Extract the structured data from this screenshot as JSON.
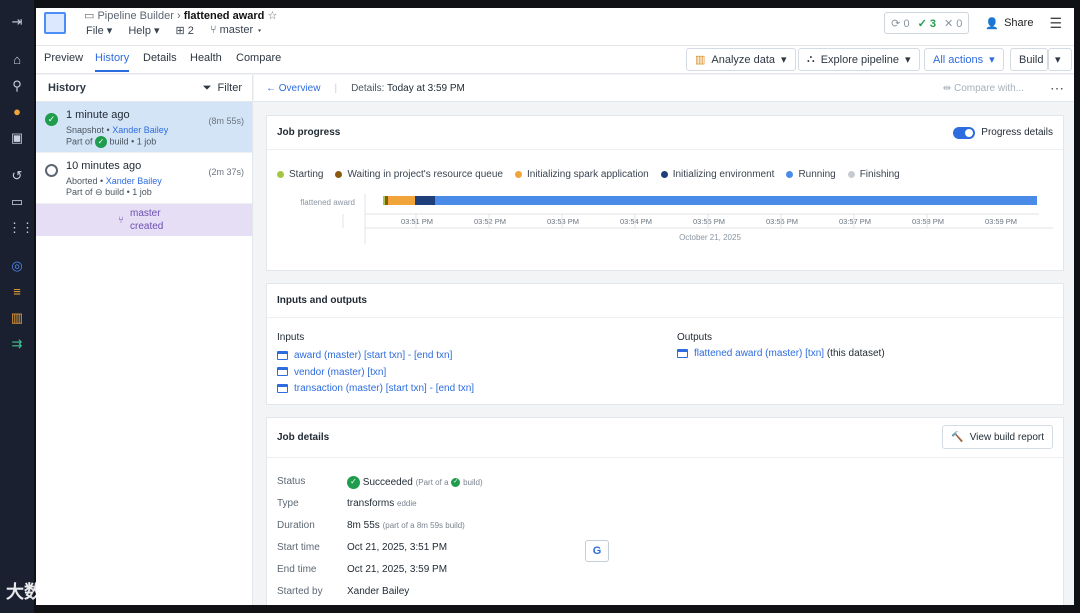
{
  "app": {
    "breadcrumb_parent": "Pipeline Builder",
    "name": "flattened award",
    "menu": [
      "File",
      "Help"
    ],
    "build_count": "2",
    "branch": "master",
    "sync_counts": {
      "pending": "0",
      "success": "3",
      "failed": "0"
    },
    "share_label": "Share"
  },
  "tabs": [
    "Preview",
    "History",
    "Details",
    "Health",
    "Compare"
  ],
  "toolbar": {
    "analyze": "Analyze data",
    "explore": "Explore pipeline",
    "actions": "All actions",
    "build": "Build"
  },
  "history": {
    "title": "History",
    "filter": "Filter",
    "items": [
      {
        "time": "1 minute ago",
        "kind": "Snapshot",
        "user": "Xander Bailey",
        "part": "Part of",
        "build": "build • 1 job",
        "duration": "(8m 55s)",
        "status": "succeeded"
      },
      {
        "time": "10 minutes ago",
        "kind": "Aborted",
        "user": "Xander Bailey",
        "part": "Part of",
        "build": "build • 1 job",
        "duration": "(2m 37s)",
        "status": "aborted"
      }
    ],
    "branch_event": {
      "line1": "master",
      "line2": "created"
    }
  },
  "main": {
    "overview": "Overview",
    "details_label": "Details:",
    "details_value": "Today at 3:59 PM",
    "compare": "Compare with..."
  },
  "job_progress": {
    "title": "Job progress",
    "toggle_label": "Progress details",
    "legend": [
      {
        "label": "Starting",
        "color": "#a3c644"
      },
      {
        "label": "Waiting in project's resource queue",
        "color": "#8a5a12"
      },
      {
        "label": "Initializing spark application",
        "color": "#f0a43a"
      },
      {
        "label": "Initializing environment",
        "color": "#1e3f7a"
      },
      {
        "label": "Running",
        "color": "#4a8be8"
      },
      {
        "label": "Finishing",
        "color": "#c7cbd1"
      }
    ],
    "row_label": "flattened award",
    "ticks": [
      "03:51 PM",
      "03:52 PM",
      "03:53 PM",
      "03:54 PM",
      "03:55 PM",
      "03:56 PM",
      "03:57 PM",
      "03:58 PM",
      "03:59 PM"
    ],
    "date": "October 21, 2025"
  },
  "io": {
    "title": "Inputs and outputs",
    "inputs_label": "Inputs",
    "outputs_label": "Outputs",
    "inputs": [
      "award (master) [start txn] - [end txn]",
      "vendor (master) [txn]",
      "transaction (master) [start txn] - [end txn]"
    ],
    "output_link": "flattened award (master) [txn]",
    "output_suffix": "(this dataset)"
  },
  "job_details": {
    "title": "Job details",
    "report_button": "View build report",
    "status_label": "Status",
    "status_value": "Succeeded",
    "status_note": "(Part of a",
    "status_note2": "build)",
    "type_label": "Type",
    "type_value": "transforms",
    "type_note": "eddie",
    "duration_label": "Duration",
    "duration_value": "8m 55s",
    "duration_note": "(part of a 8m 59s build)",
    "start_label": "Start time",
    "start_value": "Oct 21, 2025, 3:51 PM",
    "end_label": "End time",
    "end_value": "Oct 21, 2025, 3:59 PM",
    "started_by_label": "Started by",
    "started_by_value": "Xander Bailey"
  },
  "overlay": {
    "watermark": "大数跨境"
  }
}
